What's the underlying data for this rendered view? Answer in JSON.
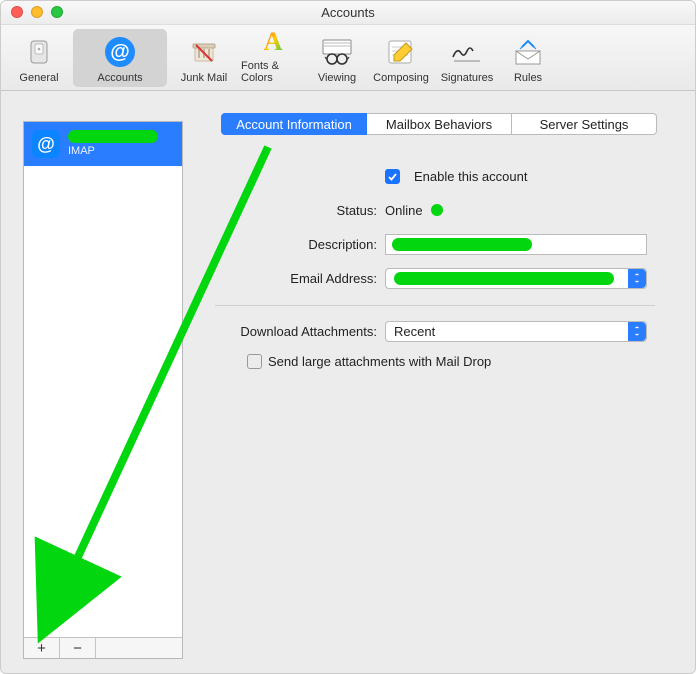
{
  "window": {
    "title": "Accounts"
  },
  "toolbar": {
    "items": [
      {
        "id": "general",
        "label": "General"
      },
      {
        "id": "accounts",
        "label": "Accounts"
      },
      {
        "id": "junkmail",
        "label": "Junk Mail"
      },
      {
        "id": "fontscolors",
        "label": "Fonts & Colors"
      },
      {
        "id": "viewing",
        "label": "Viewing"
      },
      {
        "id": "composing",
        "label": "Composing"
      },
      {
        "id": "signatures",
        "label": "Signatures"
      },
      {
        "id": "rules",
        "label": "Rules"
      }
    ],
    "selected": "accounts"
  },
  "sidebar": {
    "accounts": [
      {
        "name_redacted": true,
        "subtype": "IMAP"
      }
    ],
    "add_label": "+",
    "remove_label": "−"
  },
  "tabs": {
    "items": [
      {
        "id": "info",
        "label": "Account Information"
      },
      {
        "id": "behaviors",
        "label": "Mailbox Behaviors"
      },
      {
        "id": "server",
        "label": "Server Settings"
      }
    ],
    "active": "info"
  },
  "form": {
    "enable_label": "Enable this account",
    "enable_checked": true,
    "status_label": "Status:",
    "status_value": "Online",
    "description_label": "Description:",
    "description_redacted": true,
    "email_label": "Email Address:",
    "email_redacted": true,
    "download_label": "Download Attachments:",
    "download_value": "Recent",
    "maildrop_label": "Send large attachments with Mail Drop",
    "maildrop_checked": false
  },
  "colors": {
    "accent": "#2a7dff",
    "redacted": "#02d60e"
  }
}
